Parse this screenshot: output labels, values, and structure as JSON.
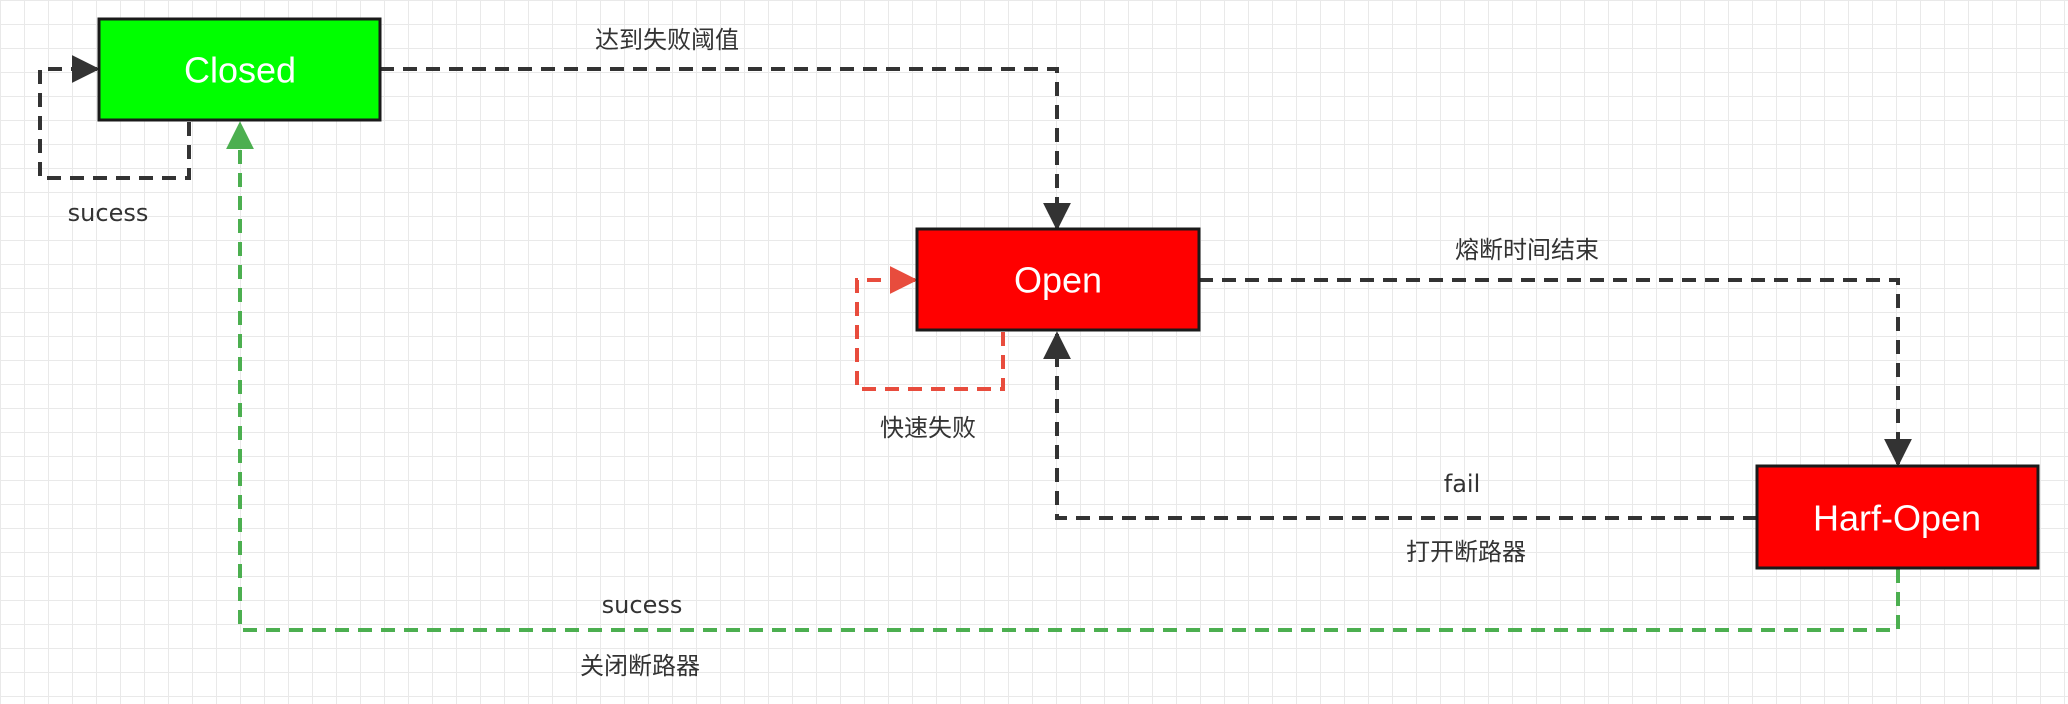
{
  "states": {
    "closed": {
      "label": "Closed",
      "color": "#00ff00"
    },
    "open": {
      "label": "Open",
      "color": "#ff0000"
    },
    "half_open": {
      "label": "Harf-Open",
      "color": "#ff0000"
    }
  },
  "edge_labels": {
    "closed_self": "sucess",
    "closed_to_open": "达到失败阈值",
    "open_self": "快速失败",
    "open_to_half_open": "熔断时间结束",
    "half_open_to_open_top": "fail",
    "half_open_to_open_bottom": "打开断路器",
    "half_open_to_closed_top": "sucess",
    "half_open_to_closed_bottom": "关闭断路器"
  },
  "colors": {
    "edge_default": "#333333",
    "edge_open_self": "#e84c3d",
    "edge_success": "#4caf50",
    "node_border": "#1a1a1a"
  }
}
